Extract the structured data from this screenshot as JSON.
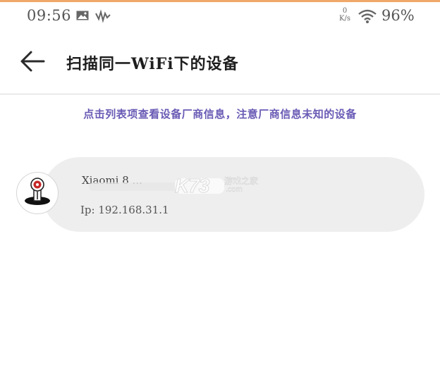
{
  "status_bar": {
    "time": "09:56",
    "speed_value": "0",
    "speed_unit": "K/s",
    "battery": "96%",
    "icons": [
      "image-icon",
      "signal-icon",
      "wifi-icon"
    ]
  },
  "header": {
    "title": "扫描同一WiFi下的设备",
    "back_icon": "arrow-left-icon"
  },
  "hint": "点击列表项查看设备厂商信息，注意厂商信息未知的设备",
  "devices": [
    {
      "name": "Xiaomi 8 ... ",
      "ip": "Ip: 192.168.31.1",
      "icon": "camera-device-icon"
    }
  ],
  "watermark": {
    "logo": "K73",
    "cn": "游戏之家",
    "domain": ".com"
  },
  "colors": {
    "accent_hint": "#6a5bb5",
    "card_bg": "#eeeeee",
    "top_line": "#f0a868"
  }
}
